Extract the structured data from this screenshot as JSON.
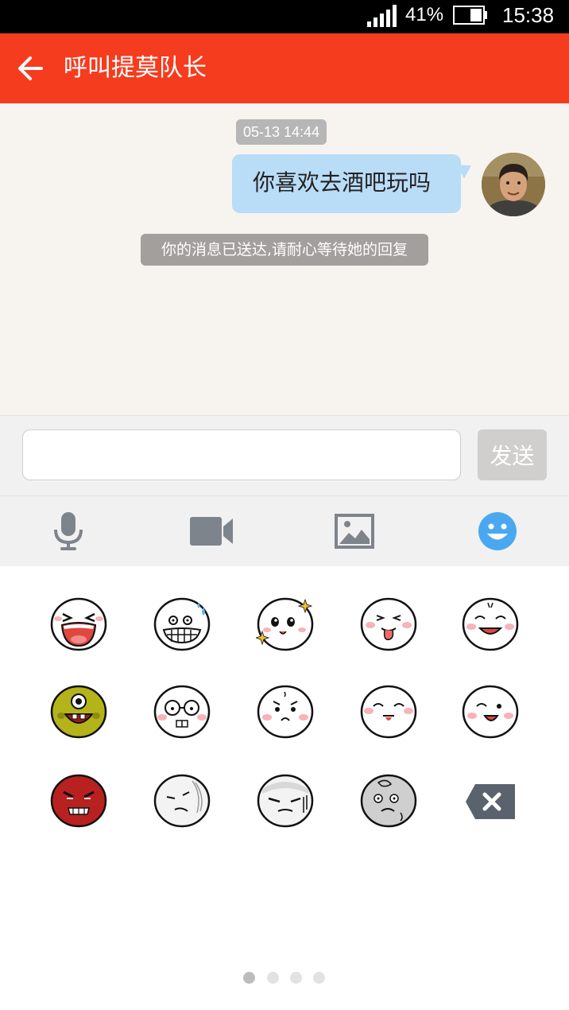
{
  "status_bar": {
    "battery_percent": "41%",
    "time": "15:38"
  },
  "header": {
    "title": "呼叫提莫队长",
    "back_icon": "arrow-left-icon"
  },
  "chat": {
    "timestamp": "05-13 14:44",
    "messages": [
      {
        "text": "你喜欢去酒吧玩吗",
        "sender": "me"
      }
    ],
    "system_note": "你的消息已送达,请耐心等待她的回复"
  },
  "input": {
    "value": "",
    "placeholder": "",
    "send_label": "发送"
  },
  "toolbar": {
    "items": [
      {
        "name": "voice",
        "icon": "microphone-icon"
      },
      {
        "name": "video",
        "icon": "video-camera-icon"
      },
      {
        "name": "photo",
        "icon": "image-icon"
      },
      {
        "name": "emoji",
        "icon": "smiley-icon",
        "active": true
      }
    ],
    "icon_color": "#7e848c",
    "active_color": "#4aa8f0"
  },
  "emoji_panel": {
    "rows": [
      [
        "laughing",
        "grinning-sweat",
        "starry-eyed",
        "tongue-out",
        "content-smile"
      ],
      [
        "green-cyclops",
        "glasses-nerd",
        "shy",
        "smug",
        "wink"
      ],
      [
        "angry-red",
        "dizzy",
        "sly",
        "crying-gray",
        "delete"
      ]
    ],
    "page_count": 4,
    "current_page": 1
  },
  "colors": {
    "brand": "#f63c1e",
    "chat_background": "#f7f4f0",
    "my_bubble": "#b9dcf7"
  }
}
